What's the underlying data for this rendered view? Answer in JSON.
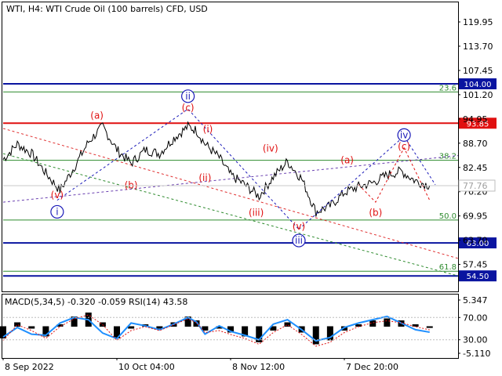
{
  "header": {
    "symbol_title": "WTI, H4:  WTI Crude Oil (100 barrels) CFD, USD",
    "indicator_title": "MACD(5,34,5) -0.320 -0.059 RSI(14) 43.58"
  },
  "colors": {
    "price_line": "#000000",
    "level_blue": "#0a14a0",
    "level_red": "#e01010",
    "fib_green": "#2e8b2e",
    "wave_red": "#e01010",
    "wave_blue": "#1a1ab8",
    "channel_red": "#e03030",
    "channel_green": "#2e8b2e",
    "channel_purple": "#6a40b0",
    "macd_blue": "#1f8fff",
    "macd_hist": "#000000"
  },
  "chart_data": [
    {
      "type": "line",
      "title": "WTI, H4:  WTI Crude Oil (100 barrels) CFD, USD",
      "x_tick_labels": [
        "8 Sep 2022",
        "10 Oct 04:00",
        "8 Nov 12:00",
        "7 Dec 20:00"
      ],
      "y_tick_labels": [
        "119.95",
        "113.70",
        "107.45",
        "101.20",
        "94.95",
        "88.70",
        "82.45",
        "76.20",
        "69.95",
        "63.70",
        "57.45"
      ],
      "ylim": [
        50.5,
        125.0
      ],
      "grid": false,
      "current_price": "77.76",
      "series": [
        {
          "x": [
            0,
            5,
            10,
            15,
            20,
            25,
            30,
            35,
            40,
            45,
            50,
            55,
            60,
            65,
            68,
            71,
            76,
            80,
            85,
            90,
            95,
            100,
            105,
            110,
            115,
            120,
            125,
            130,
            135,
            140,
            145,
            150
          ],
          "y": [
            84.5,
            88.5,
            86.0,
            81.0,
            76.5,
            82.5,
            89.0,
            93.0,
            87.0,
            83.5,
            87.0,
            86.0,
            90.0,
            93.0,
            92.0,
            88.5,
            85.0,
            80.5,
            78.0,
            75.0,
            80.0,
            84.0,
            79.5,
            71.0,
            72.5,
            76.0,
            77.5,
            78.5,
            80.5,
            81.5,
            79.0,
            77.8
          ]
        }
      ],
      "levels": [
        {
          "value": 104.0,
          "label": "104.00",
          "color": "#0a14a0"
        },
        {
          "value": 93.85,
          "label": "93.85",
          "color": "#e01010"
        },
        {
          "value": 63.0,
          "label": "63.00",
          "color": "#0a14a0"
        },
        {
          "value": 54.5,
          "label": "54.50",
          "color": "#0a14a0"
        }
      ],
      "fib_levels": [
        {
          "value": 101.9,
          "label": "23.6"
        },
        {
          "value": 84.3,
          "label": "38.2"
        },
        {
          "value": 68.9,
          "label": "50.0"
        },
        {
          "value": 55.7,
          "label": "61.8"
        }
      ],
      "wave_labels": [
        {
          "text": "(v)",
          "x": 19,
          "y": 74.5,
          "color": "red",
          "circled": false
        },
        {
          "text": "i",
          "x": 19,
          "y": 70.2,
          "color": "blue",
          "circled": true
        },
        {
          "text": "(a)",
          "x": 33,
          "y": 95.0,
          "color": "red",
          "circled": false
        },
        {
          "text": "(b)",
          "x": 45,
          "y": 77.0,
          "color": "red",
          "circled": false
        },
        {
          "text": "(c)",
          "x": 65,
          "y": 97.0,
          "color": "red",
          "circled": false
        },
        {
          "text": "ii",
          "x": 65,
          "y": 100.0,
          "color": "blue",
          "circled": true
        },
        {
          "text": "(i)",
          "x": 72,
          "y": 91.5,
          "color": "red",
          "circled": false
        },
        {
          "text": "(ii)",
          "x": 71,
          "y": 79.0,
          "color": "red",
          "circled": false
        },
        {
          "text": "(iii)",
          "x": 89,
          "y": 70.0,
          "color": "red",
          "circled": false
        },
        {
          "text": "(iv)",
          "x": 94,
          "y": 86.5,
          "color": "red",
          "circled": false
        },
        {
          "text": "(v)",
          "x": 104,
          "y": 66.5,
          "color": "red",
          "circled": false
        },
        {
          "text": "iii",
          "x": 104,
          "y": 62.8,
          "color": "blue",
          "circled": true
        },
        {
          "text": "(a)",
          "x": 121,
          "y": 83.5,
          "color": "red",
          "circled": false
        },
        {
          "text": "(b)",
          "x": 131,
          "y": 70.0,
          "color": "red",
          "circled": false
        },
        {
          "text": "(c)",
          "x": 141,
          "y": 87.0,
          "color": "red",
          "circled": false
        },
        {
          "text": "iv",
          "x": 141,
          "y": 90.0,
          "color": "blue",
          "circled": true
        }
      ],
      "forecast": {
        "red_path": [
          [
            125,
            78.0
          ],
          [
            131,
            73.5
          ],
          [
            141,
            87.5
          ],
          [
            150,
            74.0
          ]
        ],
        "blue_path": [
          [
            104,
            66.5
          ],
          [
            141,
            90.5
          ],
          [
            152,
            78.0
          ]
        ]
      }
    },
    {
      "type": "line",
      "title": "MACD(5,34,5) -0.320 -0.059 RSI(14) 43.58",
      "y_tick_labels": [
        "5.347",
        "70.00",
        "30.00",
        "-5.110"
      ],
      "ylim": [
        -6.5,
        6.5
      ],
      "series": [
        {
          "name": "RSI(14)",
          "values": [
            35,
            52,
            40,
            38,
            60,
            70,
            66,
            42,
            32,
            60,
            55,
            48,
            58,
            70,
            62,
            40,
            55,
            45,
            38,
            30,
            58,
            66,
            48,
            28,
            34,
            52,
            60,
            66,
            72,
            60,
            48,
            43.58
          ]
        },
        {
          "name": "MACD",
          "values": [
            -3.0,
            1.0,
            -0.5,
            -2.5,
            0.5,
            2.5,
            3.5,
            1.0,
            -3.0,
            -0.5,
            0.5,
            -0.5,
            1.0,
            2.5,
            1.5,
            -1.0,
            -0.5,
            -1.5,
            -2.5,
            -4.0,
            -1.0,
            1.0,
            -1.5,
            -4.5,
            -3.5,
            -1.0,
            0.5,
            1.5,
            2.0,
            1.5,
            0.5,
            -0.32
          ]
        }
      ]
    }
  ],
  "axis_current_price": "77.76"
}
